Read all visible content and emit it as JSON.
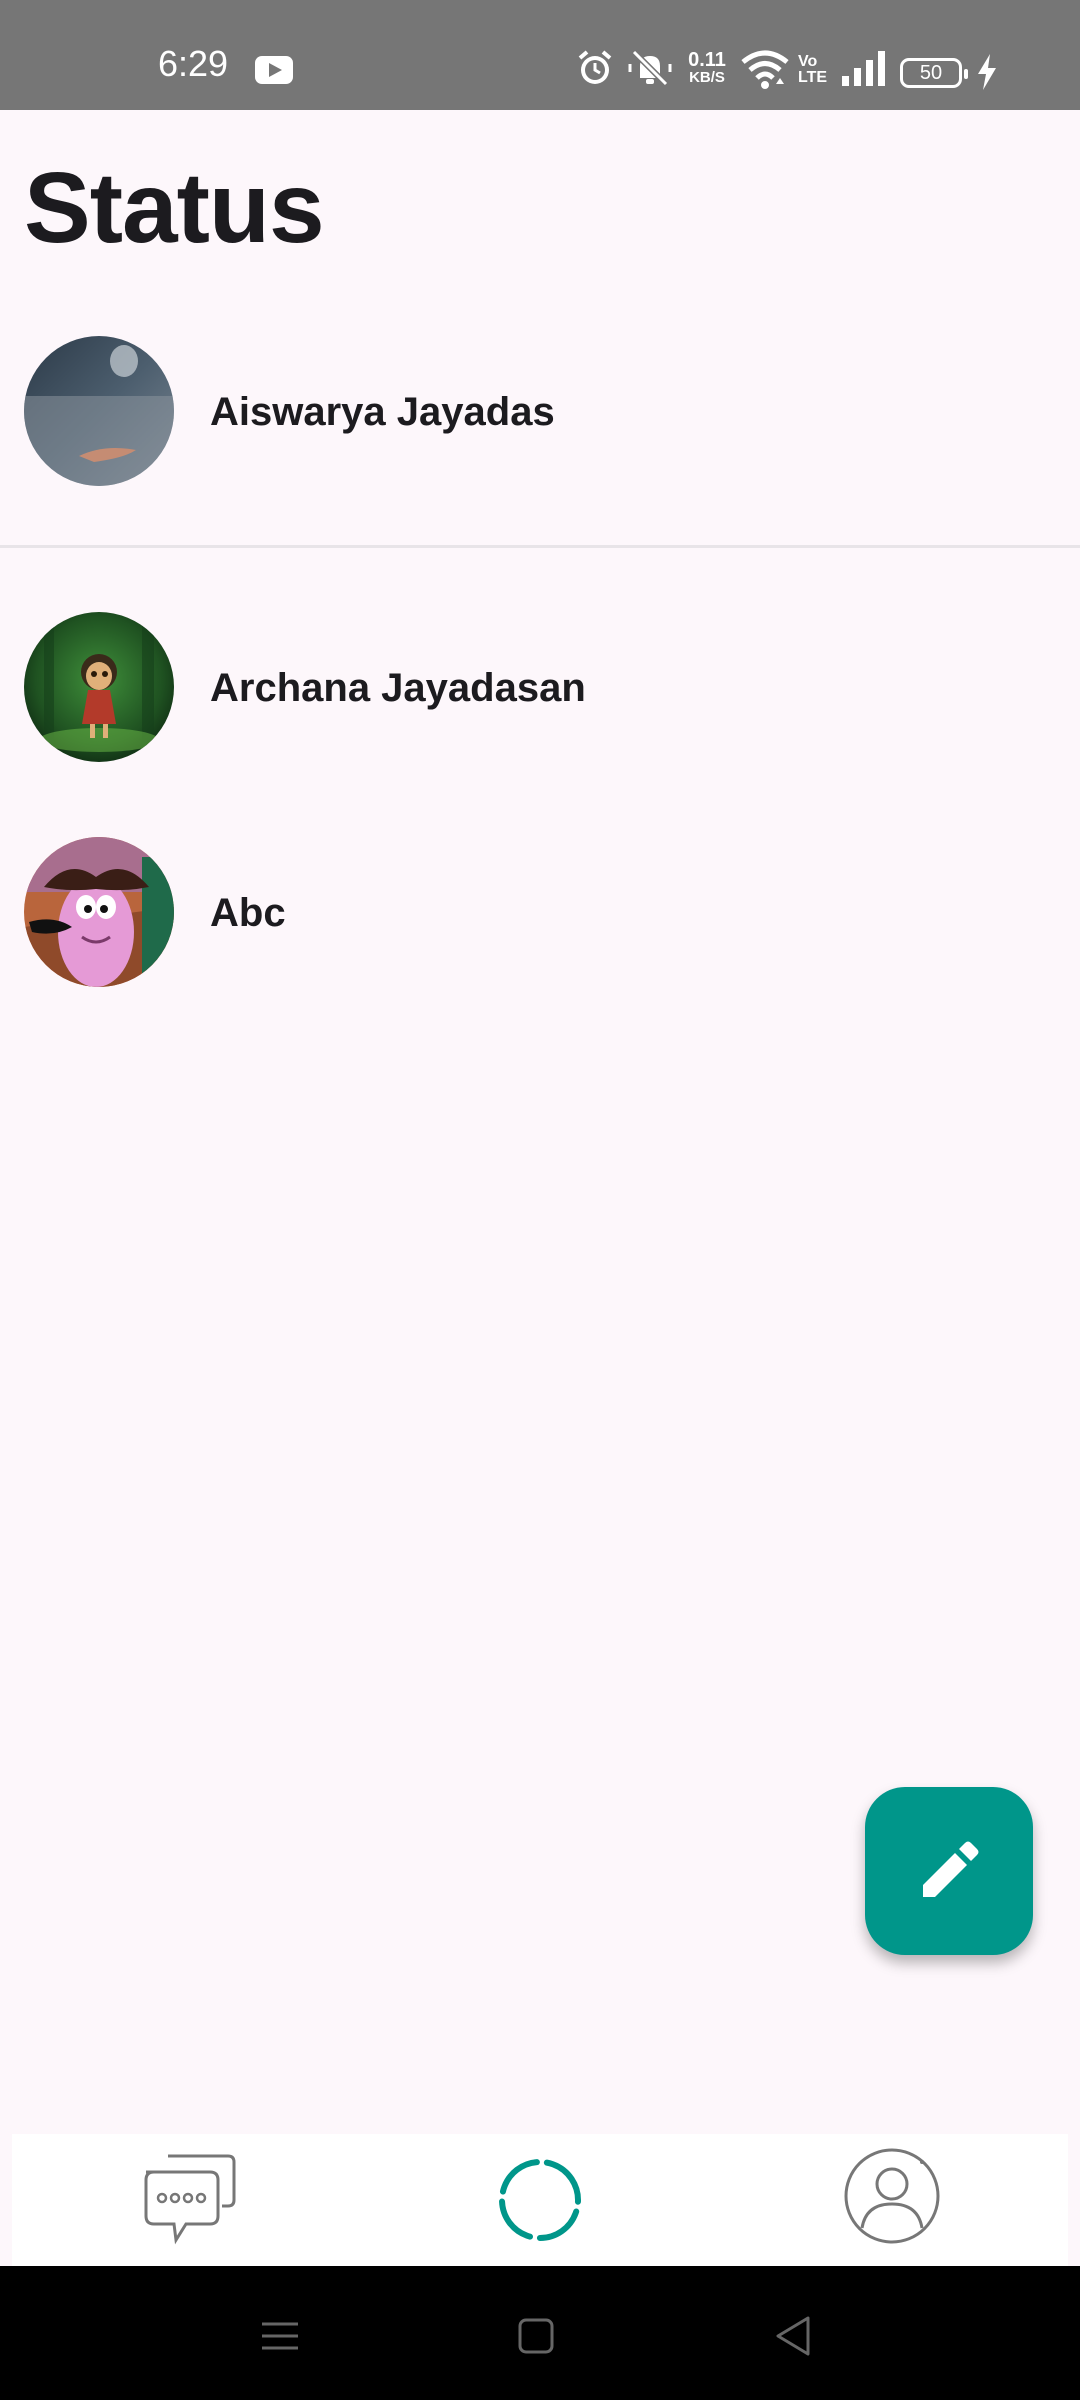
{
  "status_bar": {
    "time": "6:29",
    "net_speed_value": "0.11",
    "net_speed_unit": "KB/S",
    "volte_top": "Vo",
    "volte_bottom": "LTE",
    "battery": "50"
  },
  "page": {
    "title": "Status"
  },
  "statuses": [
    {
      "name": "Aiswarya Jayadas"
    },
    {
      "name": "Archana Jayadasan"
    },
    {
      "name": "Abc"
    }
  ],
  "colors": {
    "accent": "#00968a",
    "background": "#fdf7fb",
    "status_bar": "#767676"
  },
  "icons": {
    "fab": "pencil-icon",
    "nav": [
      "chat-icon",
      "status-icon",
      "profile-icon"
    ]
  }
}
